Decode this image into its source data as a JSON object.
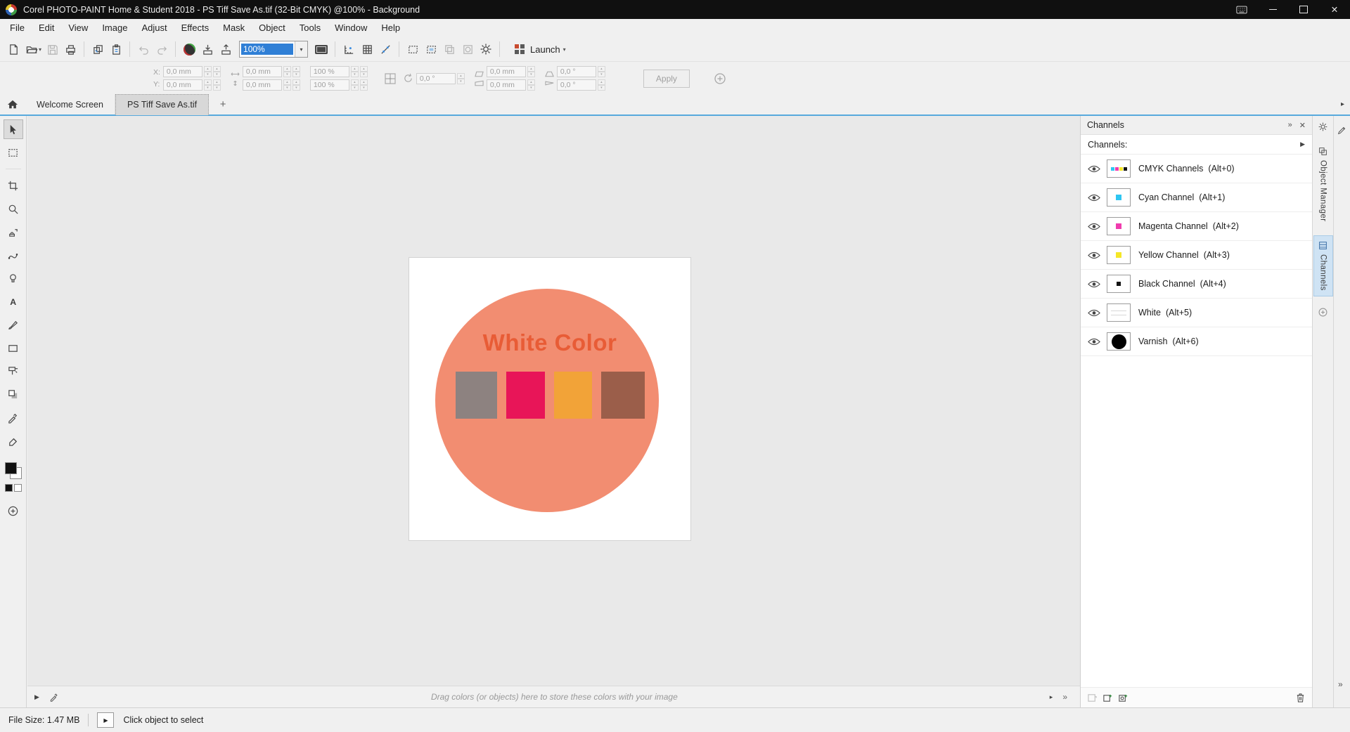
{
  "window": {
    "title": "Corel PHOTO-PAINT Home & Student 2018 - PS Tiff Save As.tif (32-Bit CMYK) @100% - Background"
  },
  "menu": {
    "items": [
      {
        "label": "File"
      },
      {
        "label": "Edit"
      },
      {
        "label": "View"
      },
      {
        "label": "Image"
      },
      {
        "label": "Adjust"
      },
      {
        "label": "Effects"
      },
      {
        "label": "Mask"
      },
      {
        "label": "Object"
      },
      {
        "label": "Tools"
      },
      {
        "label": "Window"
      },
      {
        "label": "Help"
      }
    ]
  },
  "toolbar": {
    "zoom_value": "100%",
    "launch_label": "Launch"
  },
  "property_bar": {
    "x_label": "X:",
    "y_label": "Y:",
    "x": "0,0 mm",
    "y": "0,0 mm",
    "w": "0,0 mm",
    "h": "0,0 mm",
    "scale_w": "100 %",
    "scale_h": "100 %",
    "rotation": "0,0 °",
    "skew_h": "0,0 mm",
    "skew_v": "0,0 mm",
    "persp_h": "0,0 °",
    "persp_v": "0,0 °",
    "apply": "Apply"
  },
  "document_tabs": {
    "tabs": [
      {
        "label": "Welcome Screen"
      },
      {
        "label": "PS Tiff Save As.tif"
      }
    ]
  },
  "canvas": {
    "image": {
      "title": "White Color",
      "title_color": "#e85c36",
      "circle_color": "#f28d71",
      "background": "#ffffff",
      "swatch_colors": [
        "#8d8280",
        "#e81558",
        "#f2a338",
        "#9b5e4a"
      ]
    }
  },
  "palette_bar": {
    "hint": "Drag colors (or objects) here to store these colors with your image"
  },
  "channels_panel": {
    "title": "Channels",
    "section_label": "Channels:",
    "items": [
      {
        "name": "CMYK Channels",
        "shortcut": "(Alt+0)"
      },
      {
        "name": "Cyan Channel",
        "shortcut": "(Alt+1)"
      },
      {
        "name": "Magenta Channel",
        "shortcut": "(Alt+2)"
      },
      {
        "name": "Yellow Channel",
        "shortcut": "(Alt+3)"
      },
      {
        "name": "Black Channel",
        "shortcut": "(Alt+4)"
      },
      {
        "name": "White",
        "shortcut": "(Alt+5)"
      },
      {
        "name": "Varnish",
        "shortcut": "(Alt+6)"
      }
    ],
    "colors": {
      "cyan": "#2ec6f2",
      "magenta": "#f03cae",
      "yellow": "#f5e727",
      "black": "#141414",
      "varnish": "#000000"
    }
  },
  "side_tabs": {
    "items": [
      {
        "label": "Object Manager"
      },
      {
        "label": "Channels"
      }
    ]
  },
  "status_bar": {
    "file_size": "File Size: 1.47 MB",
    "hint": "Click object to select"
  }
}
